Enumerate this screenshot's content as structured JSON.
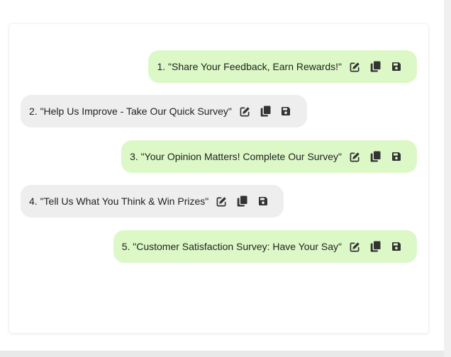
{
  "messages": [
    {
      "text": "1. \"Share Your Feedback, Earn Rewards!\"",
      "side": "right"
    },
    {
      "text": "2. \"Help Us Improve - Take Our Quick Survey\"",
      "side": "left"
    },
    {
      "text": "3. \"Your Opinion Matters! Complete Our Survey\"",
      "side": "right"
    },
    {
      "text": "4. \"Tell Us What You Think & Win Prizes\"",
      "side": "left"
    },
    {
      "text": "5. \"Customer Satisfaction Survey: Have Your Say\"",
      "side": "right"
    }
  ],
  "icons": {
    "edit": "edit-icon",
    "copy": "copy-icon",
    "save": "save-icon"
  },
  "colors": {
    "sent_bubble": "#dcf8c6",
    "received_bubble": "#eeeeee",
    "icon": "#333333",
    "text": "#222222"
  }
}
